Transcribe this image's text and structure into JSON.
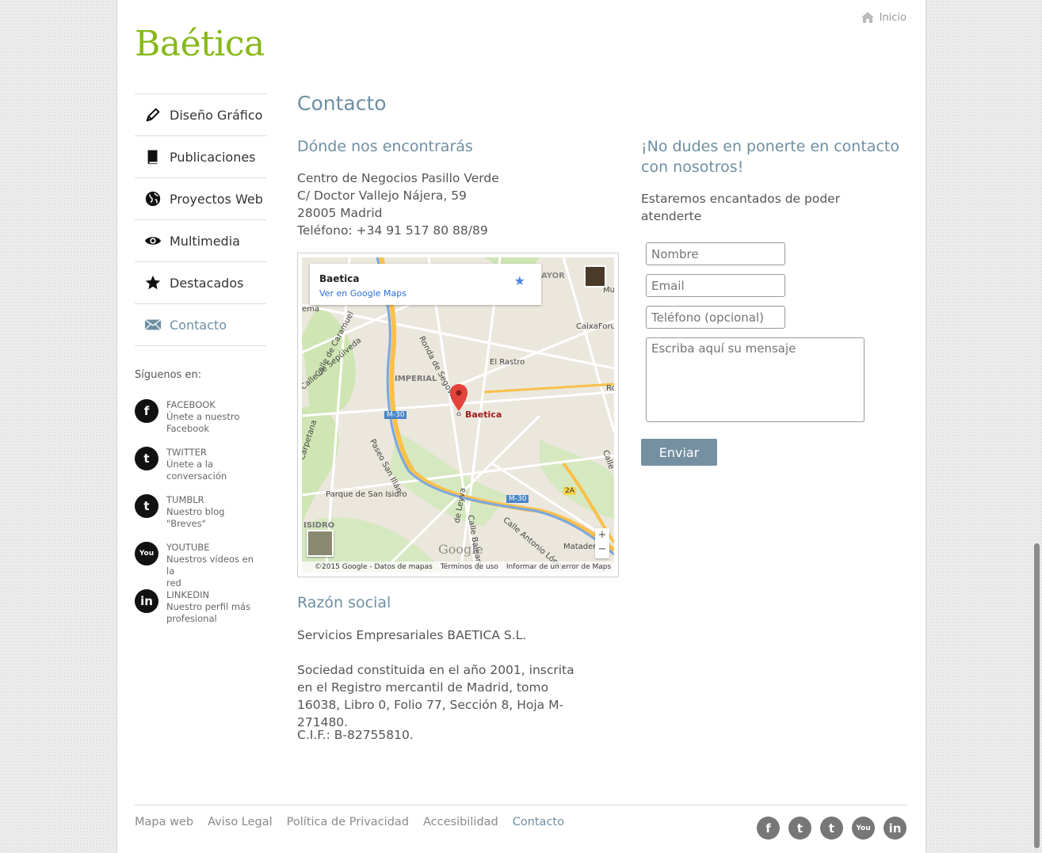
{
  "brand": {
    "logo": "Baética",
    "accent": "#86b817",
    "heading_color": "#6e8fa3"
  },
  "header": {
    "home_label": "Inicio"
  },
  "sidebar": {
    "items": [
      {
        "label": "Diseño Gráfico",
        "icon": "pencil-icon"
      },
      {
        "label": "Publicaciones",
        "icon": "book-icon"
      },
      {
        "label": "Proyectos Web",
        "icon": "globe-icon"
      },
      {
        "label": "Multimedia",
        "icon": "eye-icon"
      },
      {
        "label": "Destacados",
        "icon": "star-icon"
      },
      {
        "label": "Contacto",
        "icon": "envelope-icon",
        "active": true
      }
    ],
    "follow_title": "Síguenos en:",
    "social": [
      {
        "name": "FACEBOOK",
        "line1": "Únete a nuestro",
        "line2": "Facebook",
        "glyph": "f"
      },
      {
        "name": "TWITTER",
        "line1": "Únete a la",
        "line2": "conversación",
        "glyph": "t"
      },
      {
        "name": "TUMBLR",
        "line1": "Nuestro blog",
        "line2": "\"Breves\"",
        "glyph": "t"
      },
      {
        "name": "YOUTUBE",
        "line1": "Nuestros vídeos en la",
        "line2": "red",
        "glyph": "You"
      },
      {
        "name": "LINKEDIN",
        "line1": "Nuestro perfil más",
        "line2": "profesional",
        "glyph": "in"
      }
    ]
  },
  "main": {
    "title": "Contacto",
    "where_title": "Dónde nos encontrarás",
    "address": [
      "Centro de Negocios Pasillo Verde",
      "C/ Doctor Vallejo Nájera, 59",
      "28005 Madrid",
      "Teléfono: +34 91 517 80 88/89"
    ],
    "map": {
      "card_title": "Baetica",
      "card_link": "Ver en Google Maps",
      "marker_label": "Baetica",
      "labels": {
        "rastro": "El Rastro",
        "imperial": "IMPERIAL",
        "parque": "Parque de San Isidro",
        "isidro": "ISIDRO",
        "matadero": "Matadero",
        "caixa": "CaixaForu",
        "mayor": "AYOR",
        "m30a": "M-30",
        "m30b": "M-30",
        "ronda": "Ronda de Segovia",
        "sepulveda": "Calle de Sepúlveda",
        "caramuel": "Calle de Caramuel",
        "paseo": "Paseo San Illán",
        "antonio": "Calle Antonio López",
        "baleares": "Calle Baleares",
        "leyva": "de Leyva",
        "carpetana": "Carpetana",
        "exit": "2A",
        "mu": "Mu",
        "ro": "Ro",
        "calle": "Calle",
        "ema": "ema"
      },
      "google": "Google",
      "footer": [
        "©2015 Google - Datos de mapas",
        "Términos de uso",
        "Informar de un error de Maps"
      ],
      "zoom_in": "+",
      "zoom_out": "−"
    },
    "razon_title": "Razón social",
    "razon_lines": {
      "company": "Servicios Empresariales BAETICA S.L.",
      "society": "Sociedad constituida en el año 2001, inscrita en el Registro mercantil de Madrid, tomo 16038, Libro 0, Folio 77, Sección 8, Hoja M-271480.",
      "cif": "C.I.F.: B-82755810."
    }
  },
  "contact_form": {
    "title": "¡No dudes en ponerte en contacto con nosotros!",
    "intro": "Estaremos encantados de poder atenderte",
    "name_placeholder": "Nombre",
    "email_placeholder": "Email",
    "phone_placeholder": "Teléfono (opcional)",
    "message_placeholder": "Escriba aquí su mensaje",
    "submit": "Enviar"
  },
  "footer": {
    "links": [
      "Mapa web",
      "Aviso Legal",
      "Política de Privacidad",
      "Accesibilidad",
      "Contacto"
    ],
    "social": [
      "f",
      "t",
      "t",
      "You",
      "in"
    ]
  }
}
